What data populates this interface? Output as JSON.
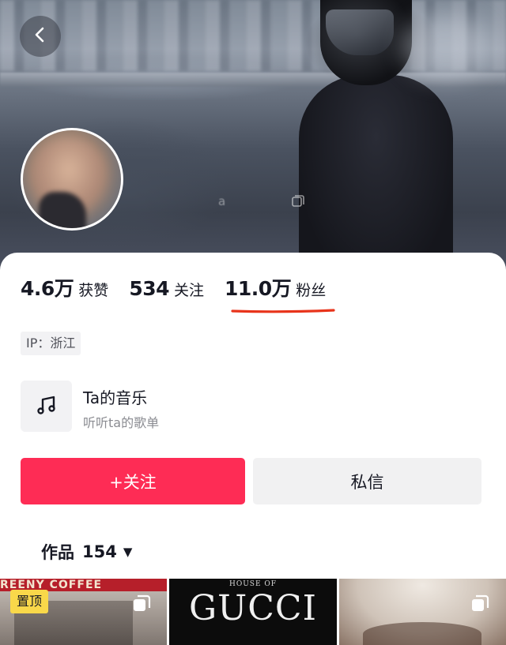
{
  "banner": {
    "watermark_text": "a",
    "back_icon": "chevron-left-icon"
  },
  "stats": {
    "likes": {
      "value": "4.6万",
      "label": "获赞"
    },
    "following": {
      "value": "534",
      "label": "关注"
    },
    "followers": {
      "value": "11.0万",
      "label": "粉丝"
    }
  },
  "highlight_color": "#e8341b",
  "ip_tag": "IP：浙江",
  "music": {
    "icon": "music-note-icon",
    "title": "Ta的音乐",
    "subtitle": "听听ta的歌单"
  },
  "actions": {
    "follow_label": "+关注",
    "follow_color": "#fe2c55",
    "message_label": "私信"
  },
  "works_tab": {
    "label": "作品",
    "count": "154",
    "caret": "▼"
  },
  "thumbnails": [
    {
      "top_text": "REENY COFFEE",
      "badge": "置顶",
      "icon": "multi-image-icon"
    },
    {
      "top_text": "HOUSE OF",
      "brand_text": "GUCCI"
    },
    {
      "icon": "multi-image-icon"
    }
  ]
}
